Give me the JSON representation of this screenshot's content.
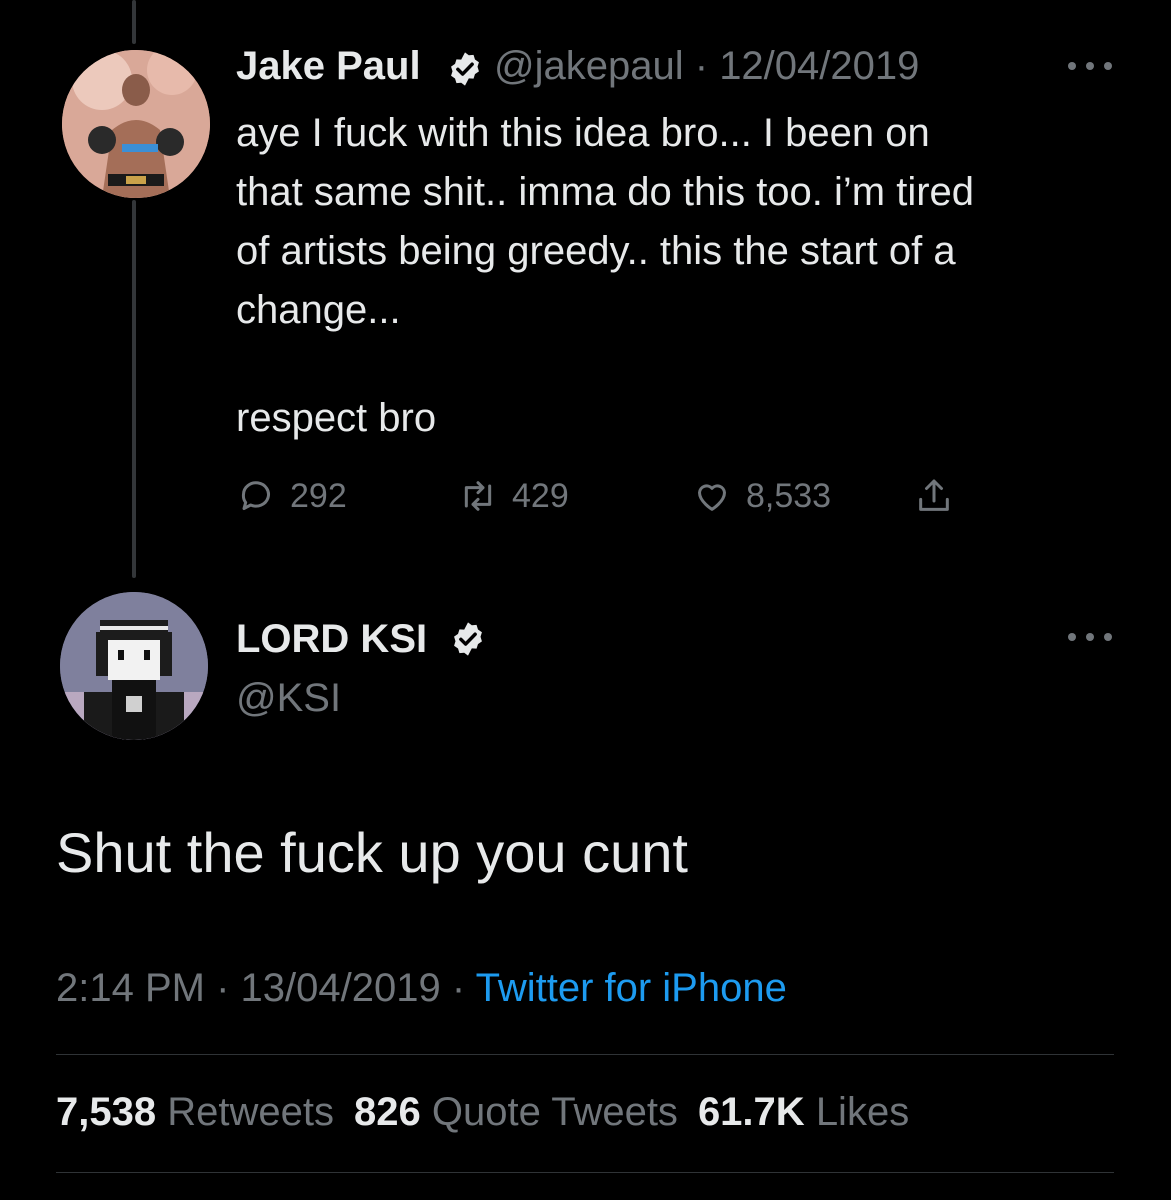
{
  "reply_tweet": {
    "author_name": "Jake Paul",
    "handle": "@jakepaul",
    "separator": "·",
    "date": "12/04/2019",
    "text_lines": [
      "aye I fuck with this idea bro... I been on",
      "that same shit.. imma do this too. i’m tired",
      "of artists being greedy.. this the start of a",
      "change..."
    ],
    "text_tail": "respect bro",
    "replies": "292",
    "retweets": "429",
    "likes": "8,533",
    "avatar_icon": "boxer-photo-avatar"
  },
  "main_tweet": {
    "author_name": "LORD KSI",
    "handle": "@KSI",
    "text": "Shut the fuck up you cunt",
    "time": "2:14 PM",
    "separator": "·",
    "date": "13/04/2019",
    "source": "Twitter for iPhone",
    "stats": {
      "retweets_count": "7,538",
      "retweets_label": "Retweets",
      "quotes_count": "826",
      "quotes_label": "Quote Tweets",
      "likes_count": "61.7K",
      "likes_label": "Likes"
    },
    "avatar_icon": "pixel-art-avatar"
  },
  "colors": {
    "background": "#000000",
    "text": "#e7e9ea",
    "muted": "#71767b",
    "link": "#1d9bf0",
    "divider": "#2f3336"
  }
}
